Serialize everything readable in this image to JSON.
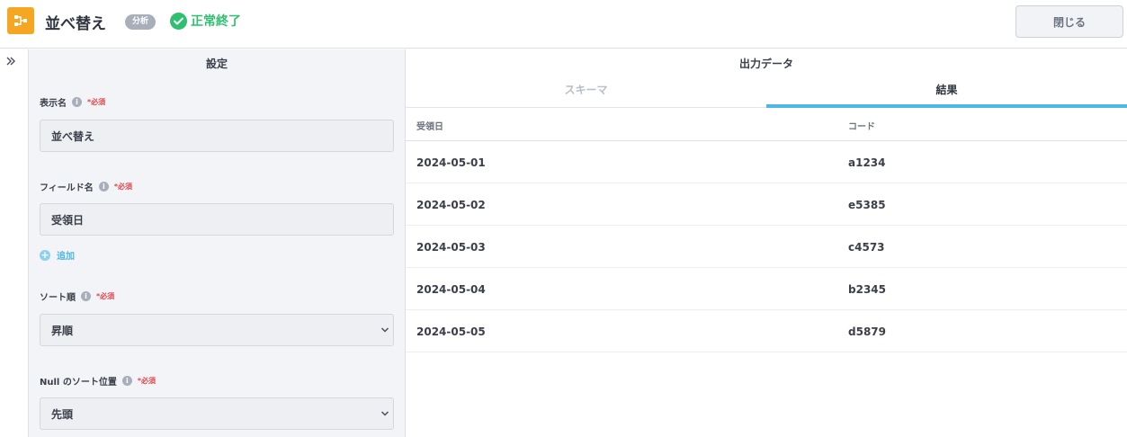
{
  "header": {
    "title": "並べ替え",
    "badge": "分析",
    "status": "正常終了",
    "close_label": "閉じる"
  },
  "settings": {
    "title": "設定",
    "required_mark": "*必須",
    "info_glyph": "i",
    "display_name": {
      "label": "表示名",
      "value": "並べ替え"
    },
    "field_name": {
      "label": "フィールド名",
      "value": "受領日"
    },
    "add_label": "追加",
    "sort_order": {
      "label": "ソート順",
      "value": "昇順"
    },
    "null_position": {
      "label": "Null のソート位置",
      "value": "先頭"
    }
  },
  "output": {
    "title": "出力データ",
    "tabs": {
      "schema": "スキーマ",
      "result": "結果"
    },
    "active_tab": "結果",
    "columns": [
      "受領日",
      "コード"
    ],
    "rows": [
      [
        "2024-05-01",
        "a1234"
      ],
      [
        "2024-05-02",
        "e5385"
      ],
      [
        "2024-05-03",
        "c4573"
      ],
      [
        "2024-05-04",
        "b2345"
      ],
      [
        "2024-05-05",
        "d5879"
      ]
    ]
  },
  "colors": {
    "accent": "#4db8e8",
    "success": "#2fbf71",
    "app_icon": "#f5a623",
    "required": "#e0454b"
  },
  "icons": {
    "app": "flow-icon",
    "status": "check-circle-icon",
    "rail": "double-chevron-right-icon",
    "info": "info-icon",
    "add": "plus-circle-icon",
    "select": "chevron-down-icon"
  }
}
